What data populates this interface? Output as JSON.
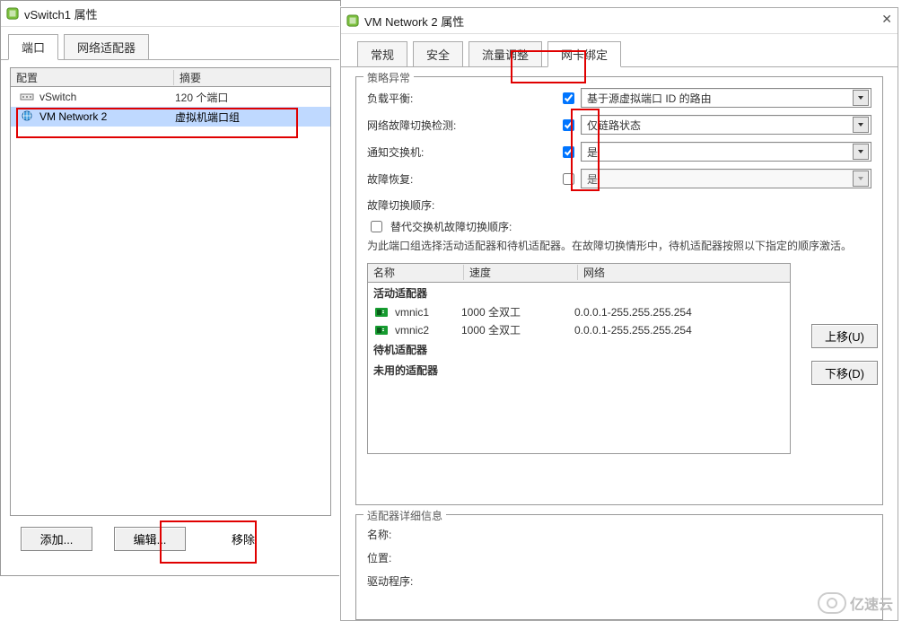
{
  "left": {
    "title": "vSwitch1 属性",
    "tabs": [
      "端口",
      "网络适配器"
    ],
    "table": {
      "hdr_config": "配置",
      "hdr_summary": "摘要",
      "rows": [
        {
          "name": "vSwitch",
          "summary": "120 个端口"
        },
        {
          "name": "VM Network 2",
          "summary": "虚拟机端口组"
        }
      ]
    },
    "btn_add": "添加...",
    "btn_edit": "编辑...",
    "btn_remove": "移除"
  },
  "right": {
    "title": "VM Network 2 属性",
    "tabs": [
      "常规",
      "安全",
      "流量调整",
      "网卡绑定"
    ],
    "panel_policy": "策略异常",
    "lbl_load_balance": "负载平衡:",
    "val_load_balance": "基于源虚拟端口 ID 的路由",
    "lbl_failover_detect": "网络故障切换检测:",
    "val_failover_detect": "仅链路状态",
    "lbl_notify": "通知交换机:",
    "val_notify": "是",
    "lbl_failback": "故障恢复:",
    "val_failback": "是",
    "lbl_failover_order": "故障切换顺序:",
    "lbl_override": "替代交换机故障切换顺序:",
    "desc_order": "为此端口组选择活动适配器和待机适配器。在故障切换情形中，待机适配器按照以下指定的顺序激活。",
    "al_hdr_name": "名称",
    "al_hdr_speed": "速度",
    "al_hdr_net": "网络",
    "sec_active": "活动适配器",
    "sec_standby": "待机适配器",
    "sec_unused": "未用的适配器",
    "nics": [
      {
        "name": "vmnic1",
        "speed": "1000 全双工",
        "net": "0.0.0.1-255.255.255.254"
      },
      {
        "name": "vmnic2",
        "speed": "1000 全双工",
        "net": "0.0.0.1-255.255.255.254"
      }
    ],
    "btn_up": "上移(U)",
    "btn_down": "下移(D)",
    "panel_detail": "适配器详细信息",
    "lbl_detail_name": "名称:",
    "lbl_detail_loc": "位置:",
    "lbl_detail_drv": "驱动程序:"
  },
  "watermark": "亿速云"
}
